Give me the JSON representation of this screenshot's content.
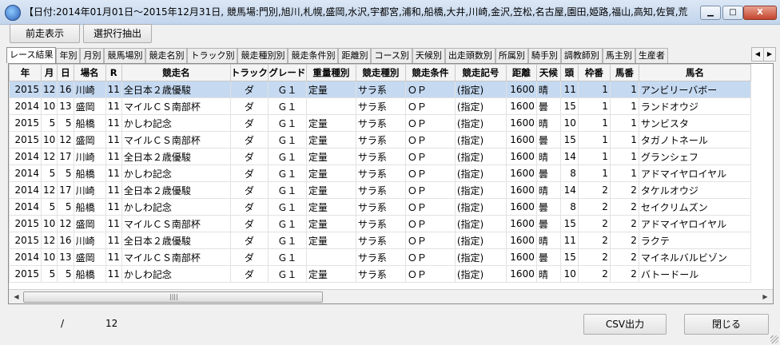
{
  "window": {
    "title": "【日付:2014年01月01日～2015年12月31日, 競馬場:門別,旭川,札幌,盛岡,水沢,宇都宮,浦和,船橋,大井,川崎,金沢,笠松,名古屋,園田,姫路,福山,高知,佐賀,荒...",
    "minimize": "▁",
    "restore": "□",
    "close": "X"
  },
  "toolbar": {
    "prev_label": "前走表示",
    "extract_label": "選択行抽出"
  },
  "tabs": [
    "レース結果",
    "年別",
    "月別",
    "競馬場別",
    "競走名別",
    "トラック別",
    "競走種別別",
    "競走条件別",
    "距離別",
    "コース別",
    "天候別",
    "出走頭数別",
    "所属別",
    "騎手別",
    "調教師別",
    "馬主別",
    "生産者"
  ],
  "tab_scroll": {
    "left": "◀",
    "right": "▶"
  },
  "columns": [
    "年",
    "月",
    "日",
    "場名",
    "R",
    "競走名",
    "トラック",
    "グレード",
    "重量種別",
    "競走種別",
    "競走条件",
    "競走記号",
    "距離",
    "天候",
    "頭",
    "枠番",
    "馬番",
    "馬名"
  ],
  "rows": [
    [
      "2015",
      "12",
      "16",
      "川崎",
      "11",
      "全日本２歳優駿",
      "ダ",
      "Ｇ１",
      "定量",
      "サラ系",
      "ＯＰ",
      "(指定)",
      "1600",
      "晴",
      "11",
      "1",
      "1",
      "アンビリーバボー"
    ],
    [
      "2014",
      "10",
      "13",
      "盛岡",
      "11",
      "マイルＣＳ南部杯",
      "ダ",
      "Ｇ１",
      "",
      "サラ系",
      "ＯＰ",
      "(指定)",
      "1600",
      "曇",
      "15",
      "1",
      "1",
      "ランドオウジ"
    ],
    [
      "2015",
      "5",
      "5",
      "船橋",
      "11",
      "かしわ記念",
      "ダ",
      "Ｇ１",
      "定量",
      "サラ系",
      "ＯＰ",
      "(指定)",
      "1600",
      "晴",
      "10",
      "1",
      "1",
      "サンビスタ"
    ],
    [
      "2015",
      "10",
      "12",
      "盛岡",
      "11",
      "マイルＣＳ南部杯",
      "ダ",
      "Ｇ１",
      "定量",
      "サラ系",
      "ＯＰ",
      "(指定)",
      "1600",
      "曇",
      "15",
      "1",
      "1",
      "タガノトネール"
    ],
    [
      "2014",
      "12",
      "17",
      "川崎",
      "11",
      "全日本２歳優駿",
      "ダ",
      "Ｇ１",
      "定量",
      "サラ系",
      "ＯＰ",
      "(指定)",
      "1600",
      "晴",
      "14",
      "1",
      "1",
      "グランシェフ"
    ],
    [
      "2014",
      "5",
      "5",
      "船橋",
      "11",
      "かしわ記念",
      "ダ",
      "Ｇ１",
      "定量",
      "サラ系",
      "ＯＰ",
      "(指定)",
      "1600",
      "曇",
      "8",
      "1",
      "1",
      "アドマイヤロイヤル"
    ],
    [
      "2014",
      "12",
      "17",
      "川崎",
      "11",
      "全日本２歳優駿",
      "ダ",
      "Ｇ１",
      "定量",
      "サラ系",
      "ＯＰ",
      "(指定)",
      "1600",
      "晴",
      "14",
      "2",
      "2",
      "タケルオウジ"
    ],
    [
      "2014",
      "5",
      "5",
      "船橋",
      "11",
      "かしわ記念",
      "ダ",
      "Ｇ１",
      "定量",
      "サラ系",
      "ＯＰ",
      "(指定)",
      "1600",
      "曇",
      "8",
      "2",
      "2",
      "セイクリムズン"
    ],
    [
      "2015",
      "10",
      "12",
      "盛岡",
      "11",
      "マイルＣＳ南部杯",
      "ダ",
      "Ｇ１",
      "定量",
      "サラ系",
      "ＯＰ",
      "(指定)",
      "1600",
      "曇",
      "15",
      "2",
      "2",
      "アドマイヤロイヤル"
    ],
    [
      "2015",
      "12",
      "16",
      "川崎",
      "11",
      "全日本２歳優駿",
      "ダ",
      "Ｇ１",
      "定量",
      "サラ系",
      "ＯＰ",
      "(指定)",
      "1600",
      "晴",
      "11",
      "2",
      "2",
      "ラクテ"
    ],
    [
      "2014",
      "10",
      "13",
      "盛岡",
      "11",
      "マイルＣＳ南部杯",
      "ダ",
      "Ｇ１",
      "",
      "サラ系",
      "ＯＰ",
      "(指定)",
      "1600",
      "曇",
      "15",
      "2",
      "2",
      "マイネルバルビゾン"
    ],
    [
      "2015",
      "5",
      "5",
      "船橋",
      "11",
      "かしわ記念",
      "ダ",
      "Ｇ１",
      "定量",
      "サラ系",
      "ＯＰ",
      "(指定)",
      "1600",
      "晴",
      "10",
      "2",
      "2",
      "バトードール"
    ]
  ],
  "scrollbar": {
    "left": "◀",
    "right": "▶",
    "grip": "||||"
  },
  "status": {
    "position": "/",
    "count": "12"
  },
  "footer": {
    "csv_label": "CSV出力",
    "close_label": "閉じる"
  },
  "colors": {
    "selected_row": "#c5d9f1",
    "titlebar": "#c2d5ec"
  }
}
